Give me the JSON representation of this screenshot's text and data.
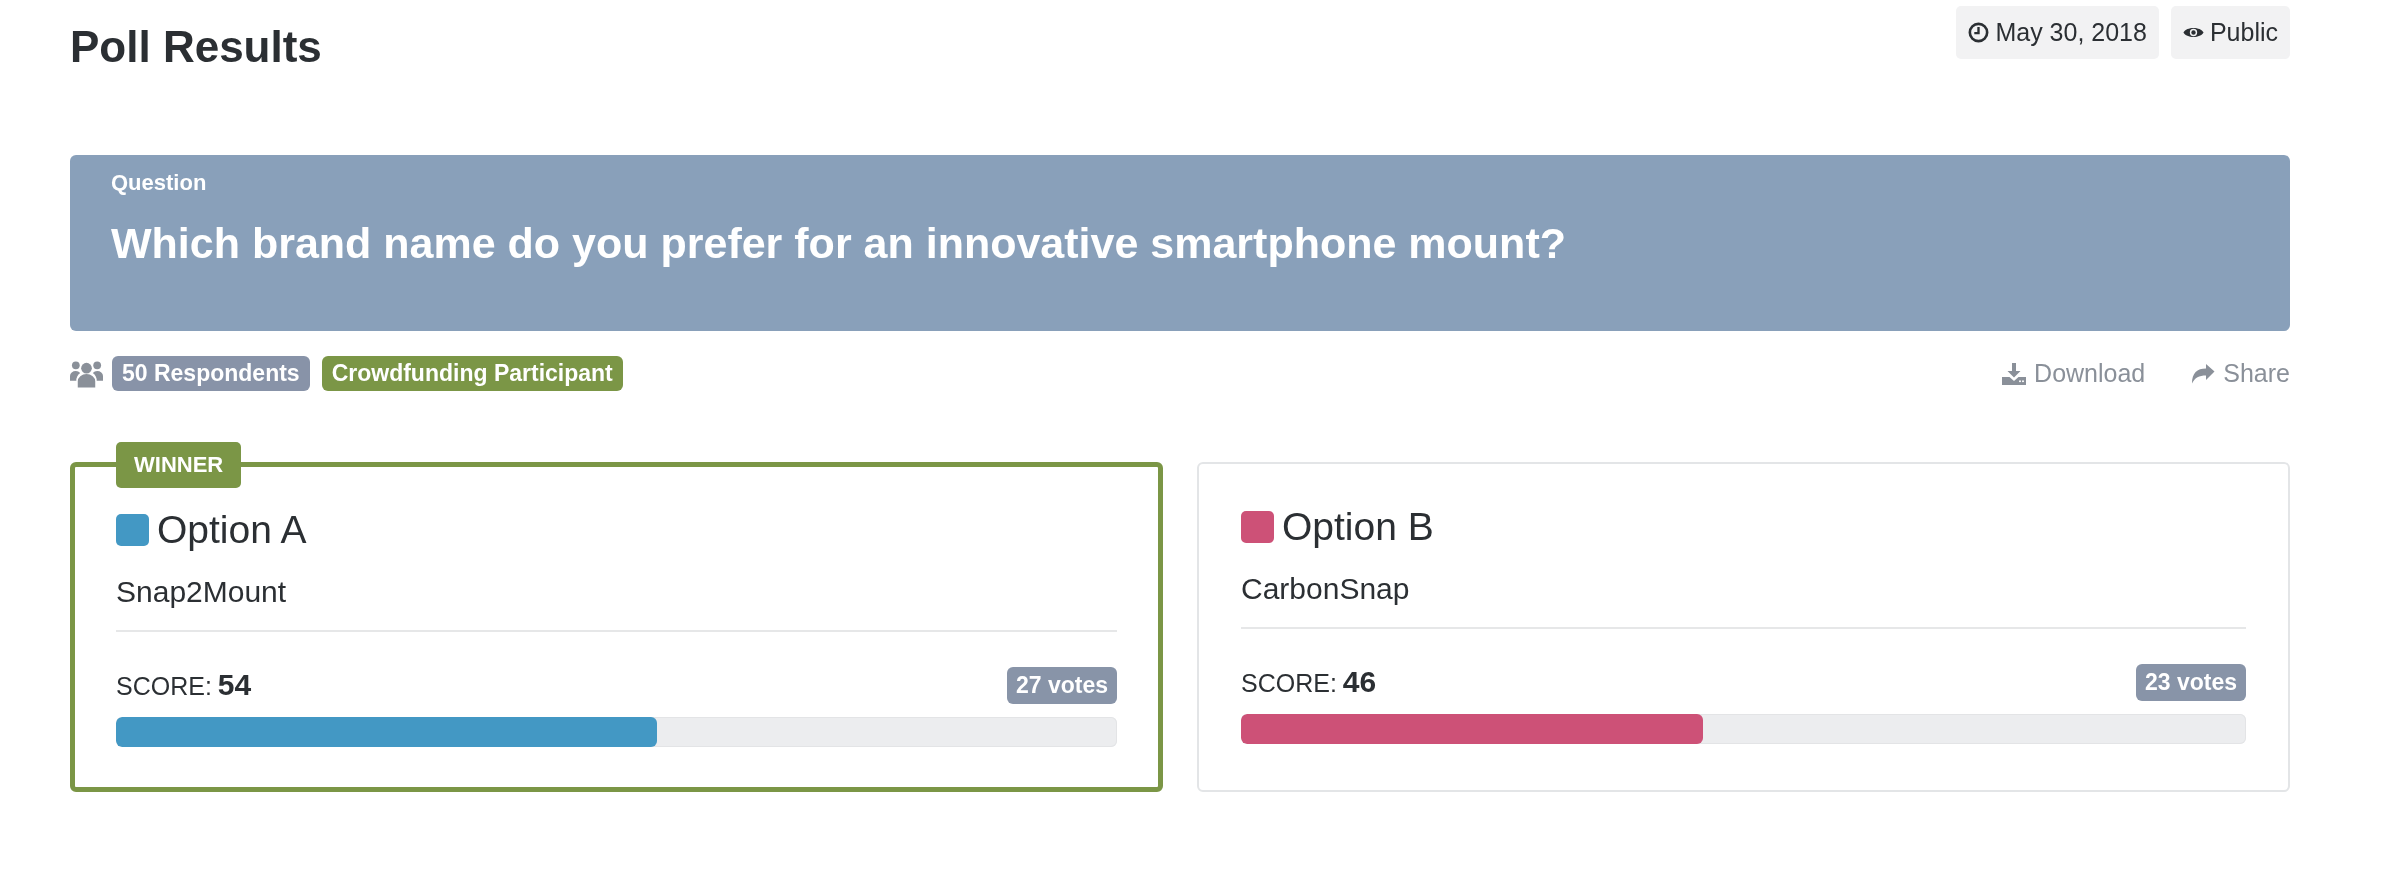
{
  "header": {
    "title": "Poll Results",
    "meta": [
      {
        "kind": "date",
        "text": "May 30, 2018"
      },
      {
        "kind": "visibility",
        "text": "Public"
      }
    ]
  },
  "question": {
    "label": "Question",
    "text": "Which brand name do you prefer for an innovative smartphone mount?"
  },
  "tags": [
    {
      "text": "50 Respondents",
      "color": "#8893a8"
    },
    {
      "text": "Crowdfunding Participant",
      "color": "#7b9646"
    }
  ],
  "actions": [
    {
      "kind": "download",
      "label": "Download"
    },
    {
      "kind": "share",
      "label": "Share"
    }
  ],
  "options": [
    {
      "title": "Option A",
      "color": "#4398c4",
      "name": "Snap2Mount",
      "score_label": "SCORE:",
      "score": "54",
      "votes": "27 votes",
      "level": 0.54,
      "winner": true,
      "badge": "WINNER"
    },
    {
      "title": "Option B",
      "color": "#cd5177",
      "name": "CarbonSnap",
      "score_label": "SCORE:",
      "score": "46",
      "votes": "23 votes",
      "level": 0.46,
      "winner": false
    }
  ]
}
